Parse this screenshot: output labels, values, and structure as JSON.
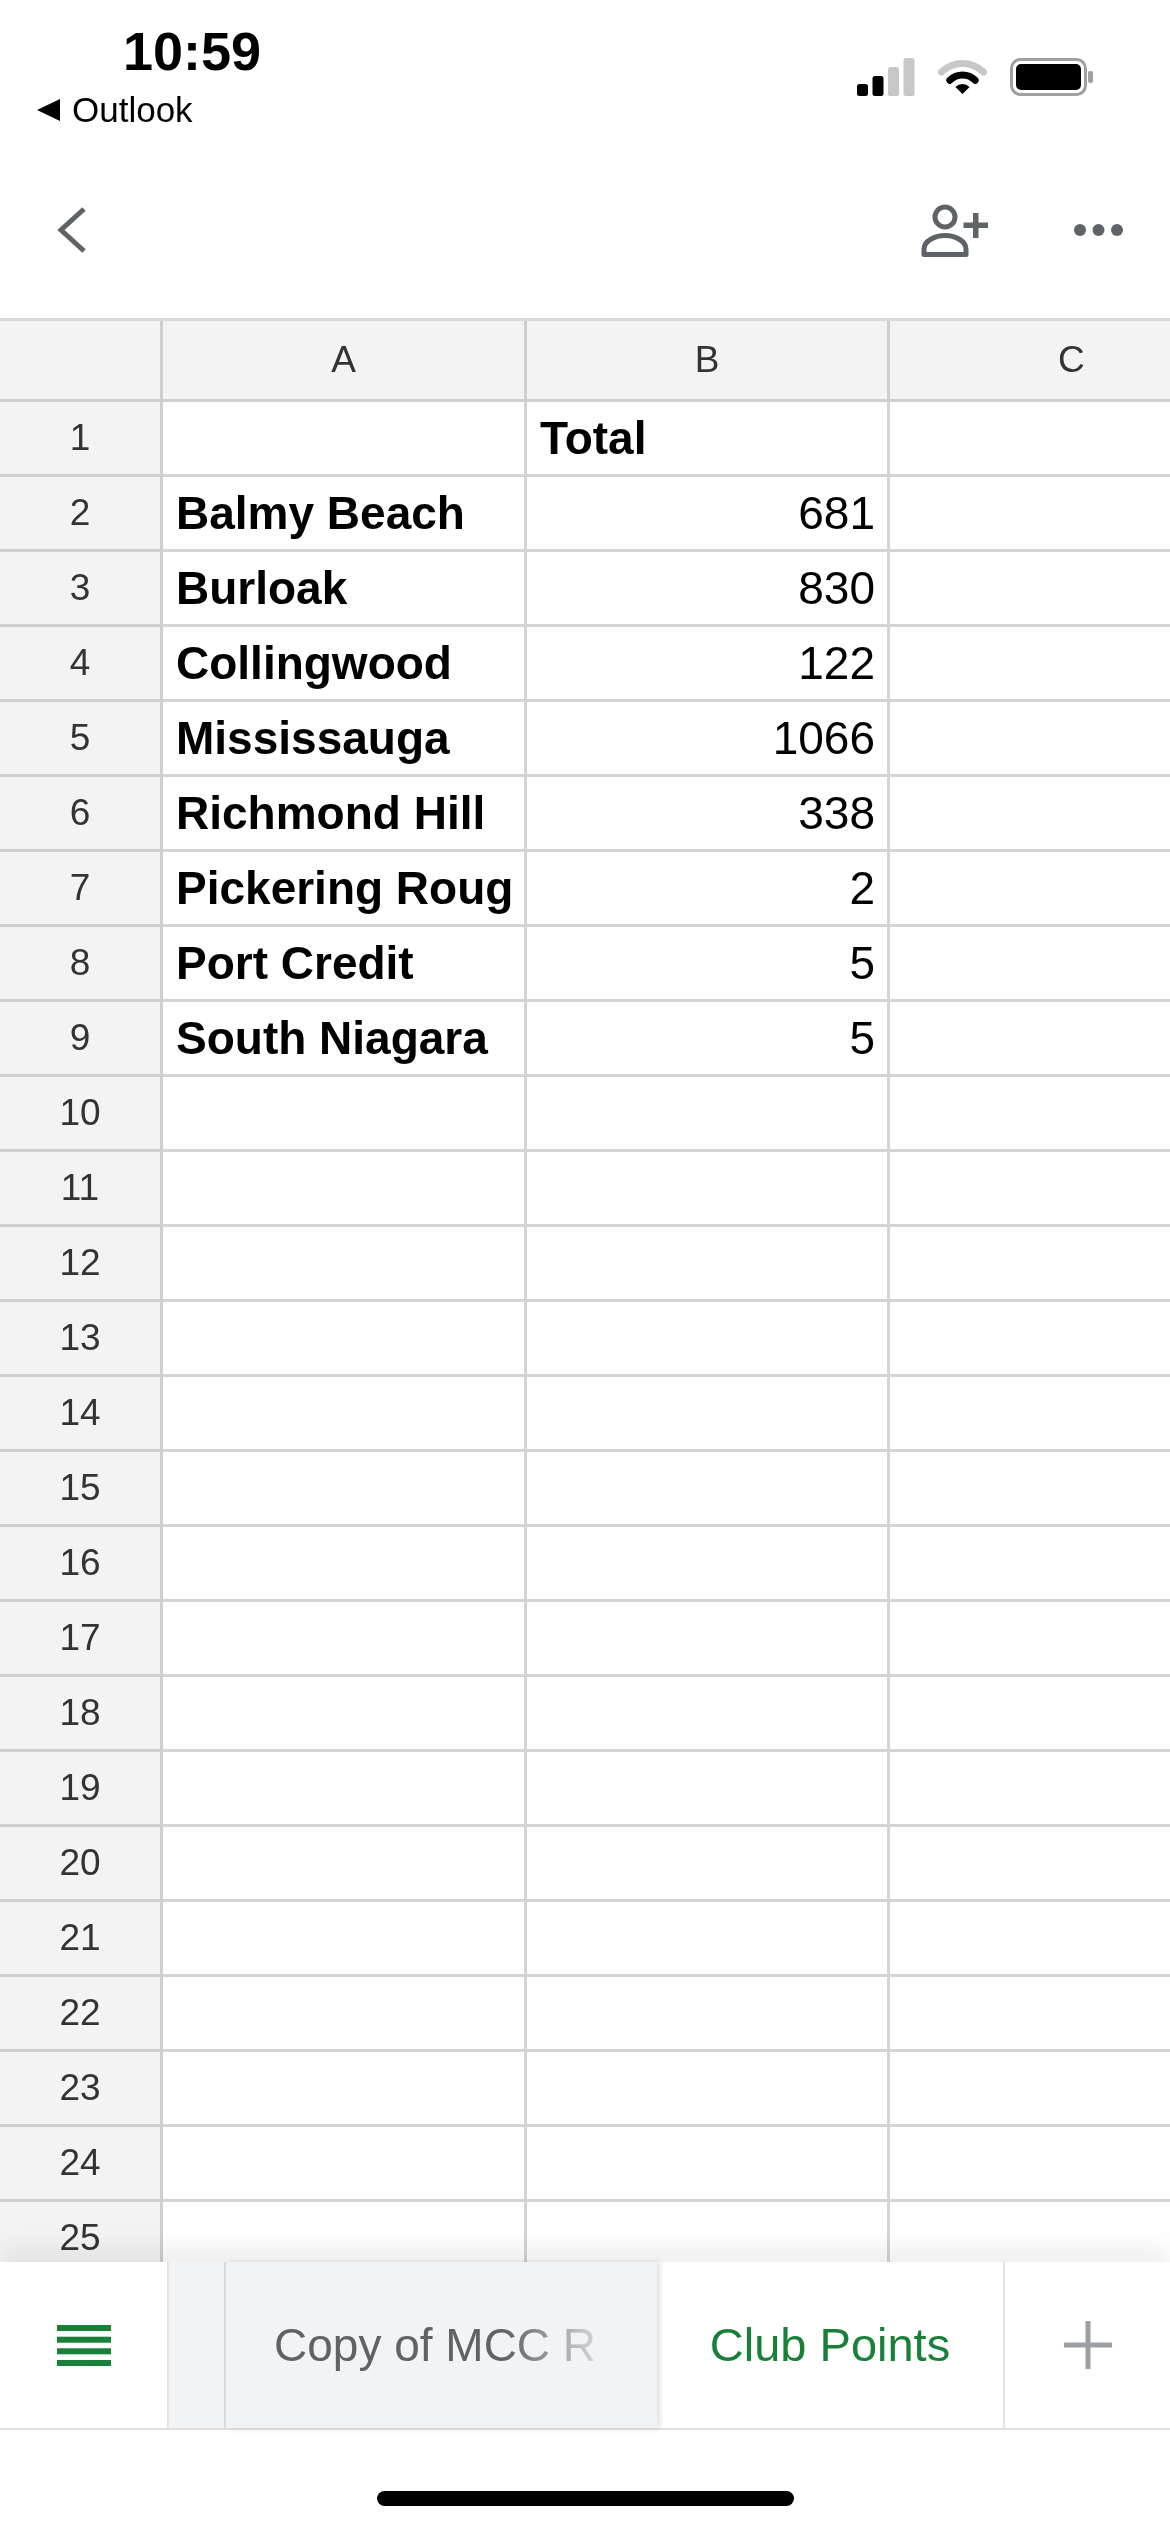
{
  "status_bar": {
    "time": "10:59",
    "back_app": "Outlook"
  },
  "sheet": {
    "columns": [
      "A",
      "B",
      "C"
    ],
    "rows": [
      {
        "number": "1",
        "column_b": {
          "kind": "text",
          "value": "Total"
        }
      },
      {
        "number": "2",
        "column_a": {
          "kind": "text",
          "value": "Balmy Beach"
        },
        "column_b": {
          "kind": "number",
          "value": "681"
        }
      },
      {
        "number": "3",
        "column_a": {
          "kind": "text",
          "value": "Burloak"
        },
        "column_b": {
          "kind": "number",
          "value": "830"
        }
      },
      {
        "number": "4",
        "column_a": {
          "kind": "text",
          "value": "Collingwood"
        },
        "column_b": {
          "kind": "number",
          "value": "122"
        }
      },
      {
        "number": "5",
        "column_a": {
          "kind": "text",
          "value": "Mississauga"
        },
        "column_b": {
          "kind": "number",
          "value": "1066"
        }
      },
      {
        "number": "6",
        "column_a": {
          "kind": "text",
          "value": "Richmond Hill"
        },
        "column_b": {
          "kind": "number",
          "value": "338"
        }
      },
      {
        "number": "7",
        "column_a": {
          "kind": "text",
          "value": "Pickering Roug"
        },
        "column_b": {
          "kind": "number",
          "value": "2"
        }
      },
      {
        "number": "8",
        "column_a": {
          "kind": "text",
          "value": "Port Credit"
        },
        "column_b": {
          "kind": "number",
          "value": "5"
        }
      },
      {
        "number": "9",
        "column_a": {
          "kind": "text",
          "value": "South Niagara"
        },
        "column_b": {
          "kind": "number",
          "value": "5"
        }
      },
      {
        "number": "10"
      },
      {
        "number": "11"
      },
      {
        "number": "12"
      },
      {
        "number": "13"
      },
      {
        "number": "14"
      },
      {
        "number": "15"
      },
      {
        "number": "16"
      },
      {
        "number": "17"
      },
      {
        "number": "18"
      },
      {
        "number": "19"
      },
      {
        "number": "20"
      },
      {
        "number": "21"
      },
      {
        "number": "22"
      },
      {
        "number": "23"
      },
      {
        "number": "24"
      },
      {
        "number": "25"
      }
    ]
  },
  "sheet_tabs": [
    {
      "label": "Copy of MCC R",
      "selected": false
    },
    {
      "label": "Club Points",
      "selected": true
    }
  ]
}
